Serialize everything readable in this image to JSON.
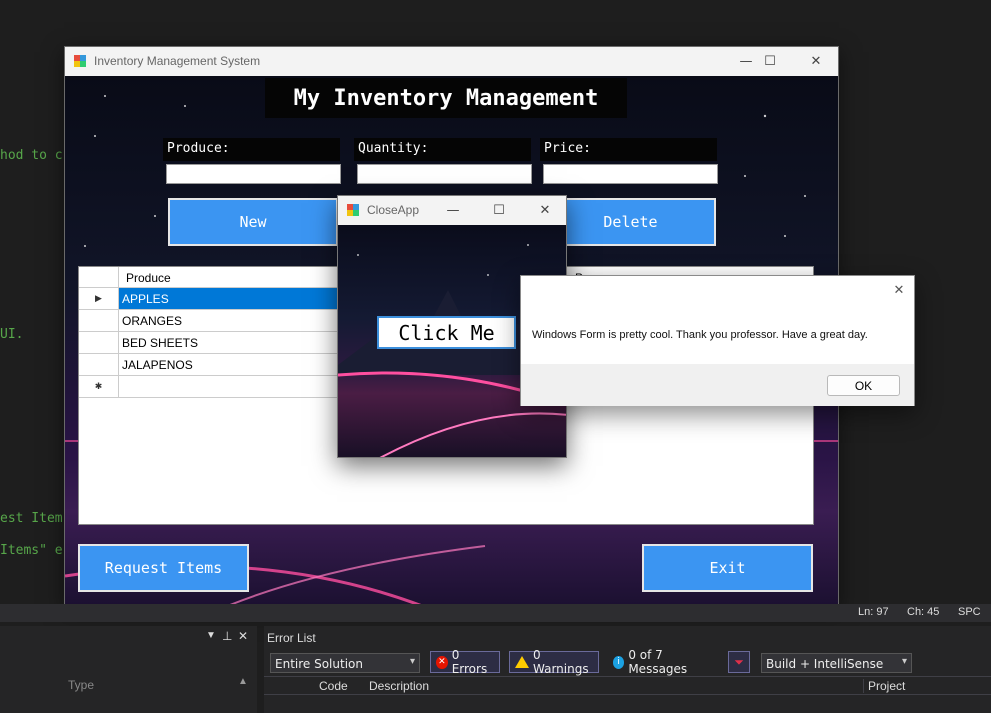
{
  "ide": {
    "code_fragments": [
      "hod to c",
      "UI.",
      "est Item",
      "Items\" e"
    ],
    "status": {
      "line": "Ln: 97",
      "col": "Ch: 45",
      "mode": "SPC"
    },
    "error_list": {
      "title": "Error List",
      "scope": "Entire Solution",
      "errors": "0 Errors",
      "warnings": "0 Warnings",
      "messages": "0 of 7 Messages",
      "build_filter": "Build + IntelliSense",
      "columns": [
        "Code",
        "Description",
        "Project"
      ]
    },
    "left_panel": {
      "column": "Type"
    }
  },
  "main_window": {
    "title": "Inventory Management System",
    "heading": "My Inventory Management",
    "fields": {
      "produce_label": "Produce:",
      "quantity_label": "Quantity:",
      "price_label": "Price:",
      "produce_value": "",
      "quantity_value": "",
      "price_value": ""
    },
    "buttons": {
      "new": "New",
      "delete": "Delete",
      "request": "Request Items",
      "exit": "Exit"
    },
    "grid": {
      "column": "Produce",
      "price_column_partial": "P",
      "rows": [
        "APPLES",
        "ORANGES",
        "BED SHEETS",
        "JALAPENOS"
      ],
      "selected_row": "APPLES",
      "current_row_glyph": "▶",
      "new_row_glyph": "✱"
    }
  },
  "close_window": {
    "title": "CloseApp",
    "button": "Click Me"
  },
  "message_box": {
    "text": "Windows Form is pretty cool. Thank you professor. Have a great day.",
    "ok": "OK"
  },
  "colors": {
    "accent_blue": "#3b95f2",
    "selection": "#0078d7",
    "ide_bg": "#1e1e1e"
  }
}
